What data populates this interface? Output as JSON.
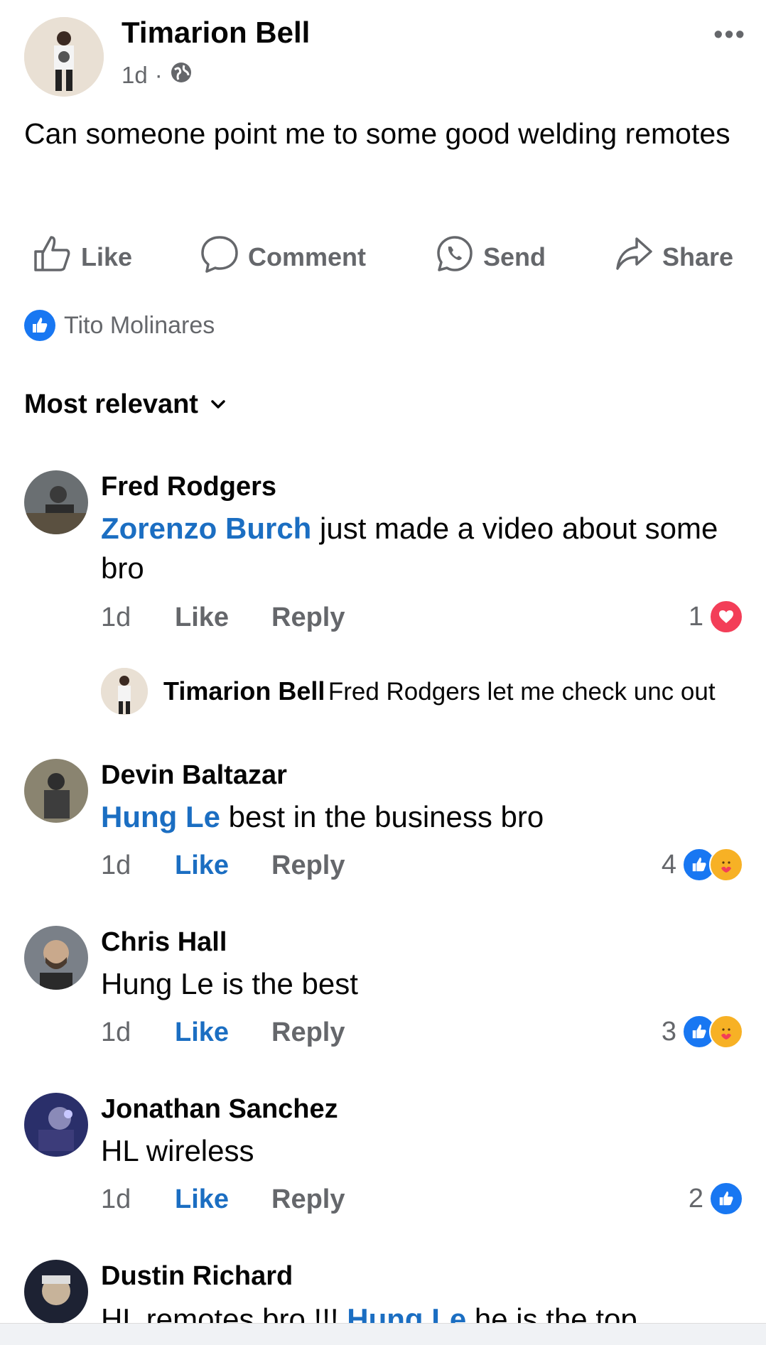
{
  "post": {
    "author": "Timarion Bell",
    "time": "1d",
    "separator": "·",
    "more": "•••",
    "text": "Can someone point me to some good welding remotes"
  },
  "actions": {
    "like": "Like",
    "comment": "Comment",
    "send": "Send",
    "share": "Share"
  },
  "likes": {
    "name": "Tito Molinares"
  },
  "sort": {
    "label": "Most relevant"
  },
  "comments": [
    {
      "name": "Fred Rodgers",
      "mention": "Zorenzo Burch",
      "text": " just made a video about some bro",
      "time": "1d",
      "like": "Like",
      "reply": "Reply",
      "count": "1",
      "reactions": [
        "love"
      ]
    },
    {
      "name": "Devin Baltazar",
      "mention": "Hung Le",
      "text": " best in the business bro",
      "time": "1d",
      "like": "Like",
      "reply": "Reply",
      "count": "4",
      "reactions": [
        "like",
        "care"
      ]
    },
    {
      "name": "Chris Hall",
      "text": "Hung Le is the best",
      "time": "1d",
      "like": "Like",
      "reply": "Reply",
      "count": "3",
      "reactions": [
        "like",
        "care"
      ]
    },
    {
      "name": "Jonathan Sanchez",
      "text": "HL wireless",
      "time": "1d",
      "like": "Like",
      "reply": "Reply",
      "count": "2",
      "reactions": [
        "like"
      ]
    },
    {
      "name": "Dustin Richard",
      "text_before": "HL remotes bro !!! ",
      "mention": "Hung Le",
      "text_after": " he is the top"
    }
  ],
  "reply": {
    "name": "Timarion Bell",
    "text": "Fred Rodgers let me check unc out"
  },
  "colors": {
    "link": "#1b6ec2",
    "like_blue": "#1877f2",
    "love_red": "#f33e58",
    "care_yellow": "#f7b125",
    "muted": "#65676b"
  }
}
